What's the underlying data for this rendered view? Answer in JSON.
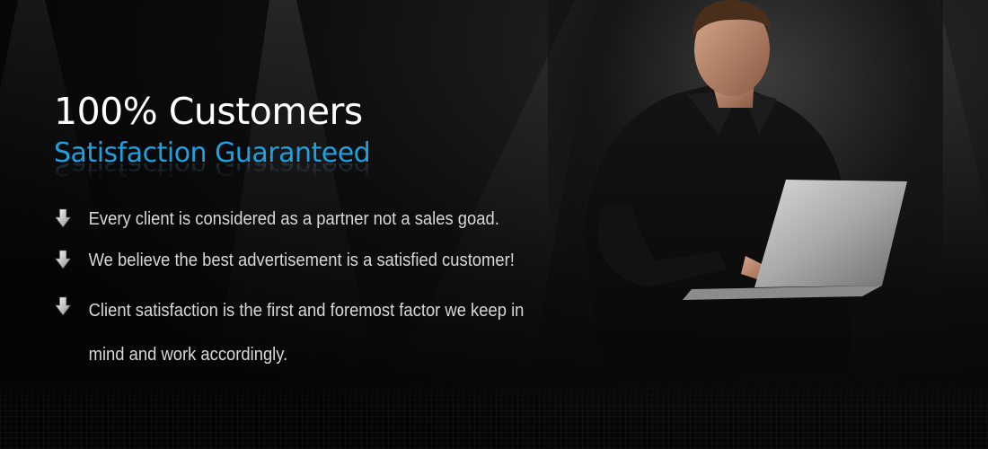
{
  "banner": {
    "headline": "100% Customers",
    "subheadline": "Satisfaction Guaranteed",
    "bullets": [
      {
        "icon": "arrow-down-icon",
        "text": "Every client is considered as a partner not a sales goad."
      },
      {
        "icon": "arrow-down-icon",
        "text": "We believe the best advertisement is a satisfied customer!"
      },
      {
        "icon": "arrow-down-icon",
        "text": "Client satisfaction is the first and foremost factor we keep in mind and work accordingly."
      }
    ],
    "photo": "man-with-laptop-photo"
  },
  "colors": {
    "background": "#050505",
    "headline": "#ffffff",
    "accent": "#1da1e0",
    "bullet_text": "#d8d8d8"
  }
}
